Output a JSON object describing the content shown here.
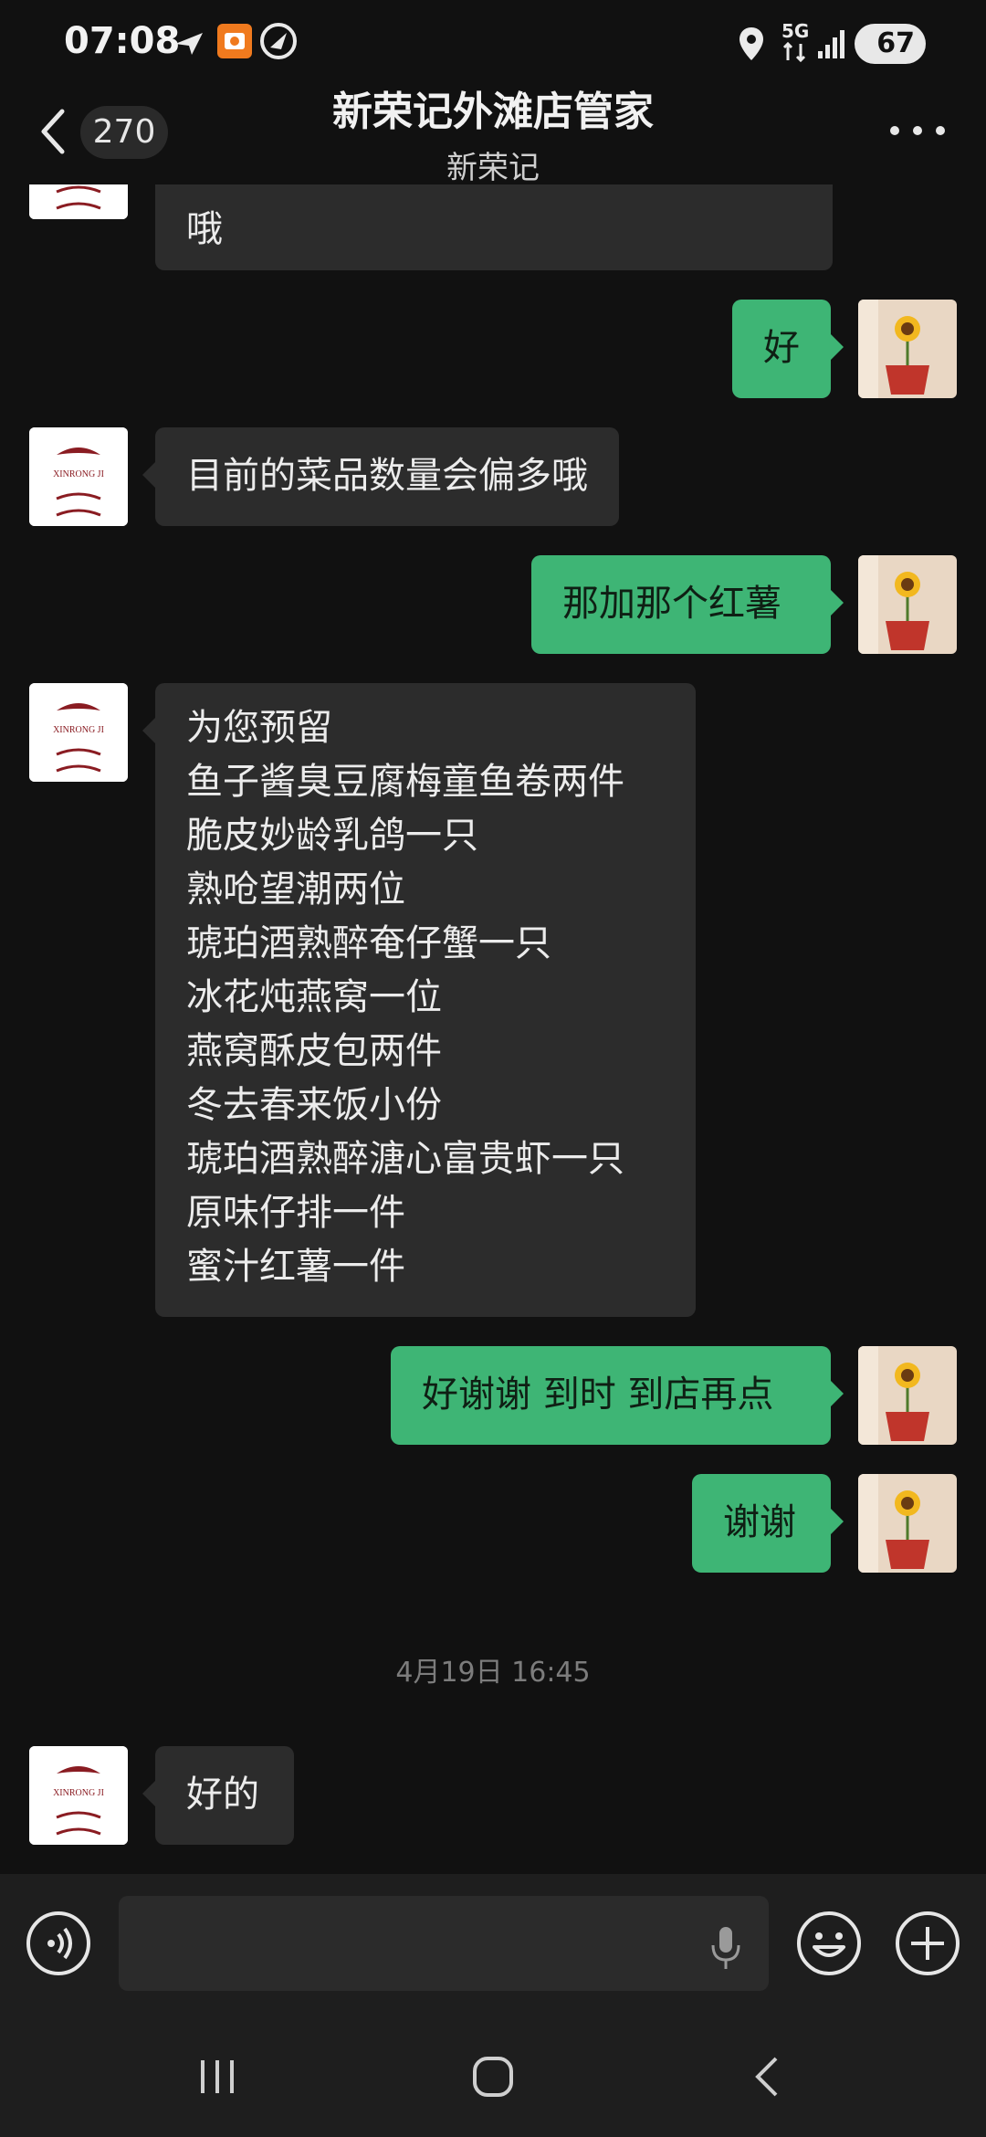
{
  "status_bar": {
    "time": "07:08",
    "network": "5G",
    "battery": "67"
  },
  "header": {
    "unread_count": "270",
    "title": "新荣记外滩店管家",
    "subtitle": "新荣记"
  },
  "messages": [
    {
      "side": "in",
      "lines": [
        "哦"
      ]
    },
    {
      "side": "out",
      "lines": [
        "好"
      ]
    },
    {
      "side": "in",
      "lines": [
        "目前的菜品数量会偏多哦"
      ]
    },
    {
      "side": "out",
      "lines": [
        "那加那个红薯"
      ]
    },
    {
      "side": "in",
      "lines": [
        "为您预留",
        "鱼子酱臭豆腐梅童鱼卷两件",
        "脆皮妙龄乳鸽一只",
        "熟呛望潮两位",
        "琥珀酒熟醉奄仔蟹一只",
        "冰花炖燕窝一位",
        "燕窝酥皮包两件",
        "冬去春来饭小份",
        "琥珀酒熟醉溏心富贵虾一只",
        "原味仔排一件",
        "蜜汁红薯一件"
      ]
    },
    {
      "side": "out",
      "lines": [
        "好谢谢 到时 到店再点"
      ]
    },
    {
      "side": "out",
      "lines": [
        "谢谢"
      ]
    },
    {
      "side": "in",
      "lines": [
        "好的"
      ]
    }
  ],
  "timestamp": "4月19日 16:45",
  "avatar_logo_text": "XINRONG JI",
  "colors": {
    "background": "#111111",
    "incoming_bubble": "#2c2c2c",
    "outgoing_bubble": "#3eb575"
  }
}
